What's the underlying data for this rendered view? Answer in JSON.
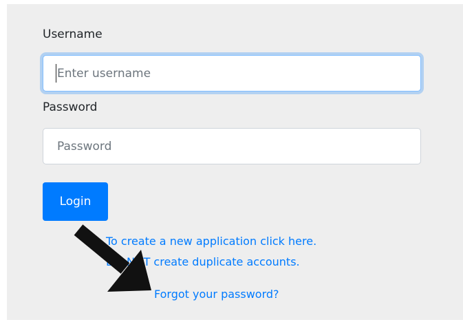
{
  "form": {
    "username_label": "Username",
    "username_placeholder": "Enter username",
    "password_label": "Password",
    "password_placeholder": "Password",
    "login_label": "Login"
  },
  "links": {
    "create_application": "To create a new application click here.",
    "duplicate_warning": "DO NOT create duplicate accounts.",
    "forgot_password": "Forgot your password?"
  },
  "colors": {
    "panel_background": "#eeeeee",
    "primary": "#007bff",
    "annotation_arrow": "#111111"
  },
  "annotation": {
    "icon": "arrow-annotation-icon"
  }
}
